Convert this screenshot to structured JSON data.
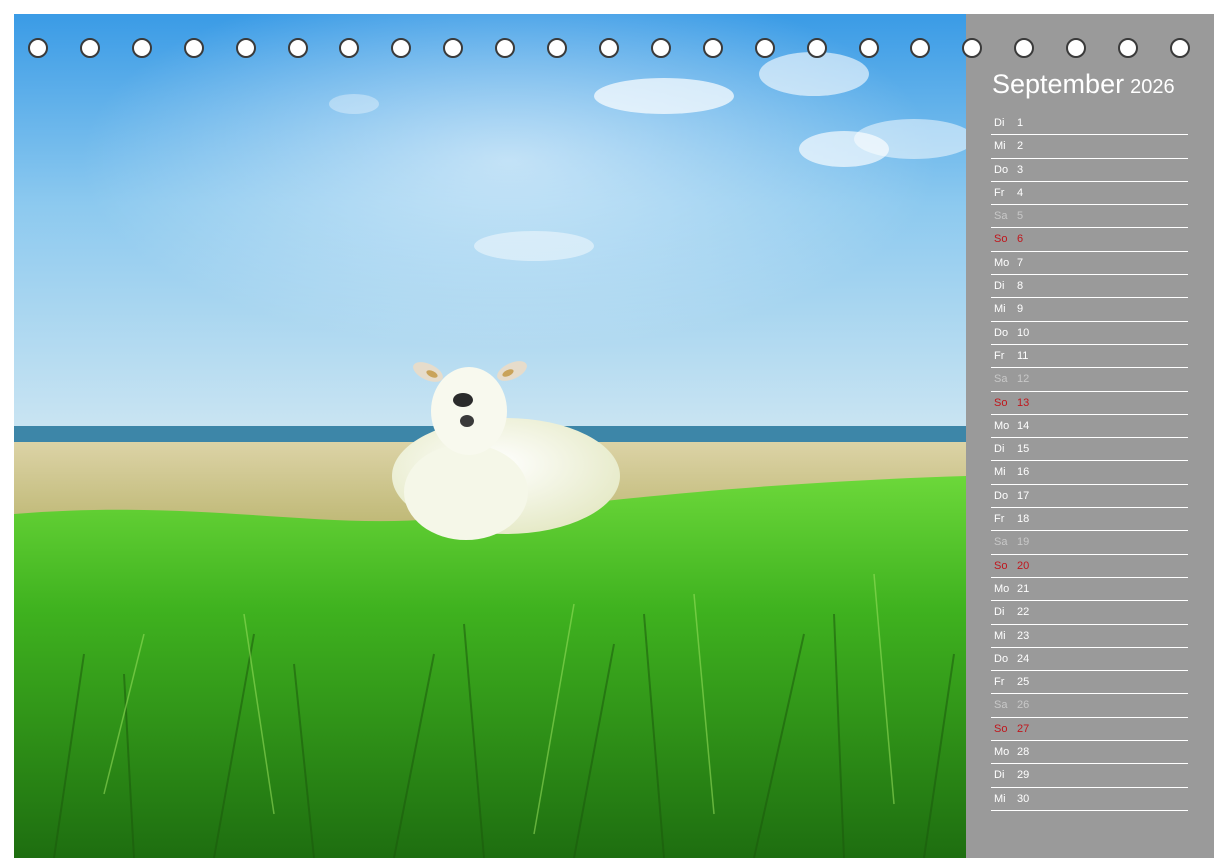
{
  "calendar": {
    "month": "September",
    "year": "2026",
    "days": [
      {
        "dow": "Di",
        "num": "1",
        "type": "weekday"
      },
      {
        "dow": "Mi",
        "num": "2",
        "type": "weekday"
      },
      {
        "dow": "Do",
        "num": "3",
        "type": "weekday"
      },
      {
        "dow": "Fr",
        "num": "4",
        "type": "weekday"
      },
      {
        "dow": "Sa",
        "num": "5",
        "type": "saturday"
      },
      {
        "dow": "So",
        "num": "6",
        "type": "sunday"
      },
      {
        "dow": "Mo",
        "num": "7",
        "type": "weekday"
      },
      {
        "dow": "Di",
        "num": "8",
        "type": "weekday"
      },
      {
        "dow": "Mi",
        "num": "9",
        "type": "weekday"
      },
      {
        "dow": "Do",
        "num": "10",
        "type": "weekday"
      },
      {
        "dow": "Fr",
        "num": "11",
        "type": "weekday"
      },
      {
        "dow": "Sa",
        "num": "12",
        "type": "saturday"
      },
      {
        "dow": "So",
        "num": "13",
        "type": "sunday"
      },
      {
        "dow": "Mo",
        "num": "14",
        "type": "weekday"
      },
      {
        "dow": "Di",
        "num": "15",
        "type": "weekday"
      },
      {
        "dow": "Mi",
        "num": "16",
        "type": "weekday"
      },
      {
        "dow": "Do",
        "num": "17",
        "type": "weekday"
      },
      {
        "dow": "Fr",
        "num": "18",
        "type": "weekday"
      },
      {
        "dow": "Sa",
        "num": "19",
        "type": "saturday"
      },
      {
        "dow": "So",
        "num": "20",
        "type": "sunday"
      },
      {
        "dow": "Mo",
        "num": "21",
        "type": "weekday"
      },
      {
        "dow": "Di",
        "num": "22",
        "type": "weekday"
      },
      {
        "dow": "Mi",
        "num": "23",
        "type": "weekday"
      },
      {
        "dow": "Do",
        "num": "24",
        "type": "weekday"
      },
      {
        "dow": "Fr",
        "num": "25",
        "type": "weekday"
      },
      {
        "dow": "Sa",
        "num": "26",
        "type": "saturday"
      },
      {
        "dow": "So",
        "num": "27",
        "type": "sunday"
      },
      {
        "dow": "Mo",
        "num": "28",
        "type": "weekday"
      },
      {
        "dow": "Di",
        "num": "29",
        "type": "weekday"
      },
      {
        "dow": "Mi",
        "num": "30",
        "type": "weekday"
      }
    ]
  },
  "binding": {
    "ring_count": 23
  },
  "colors": {
    "sidebar": "#9a9a9a",
    "sunday": "#c0161c",
    "saturday": "#c8c8c8",
    "text": "#ffffff"
  }
}
